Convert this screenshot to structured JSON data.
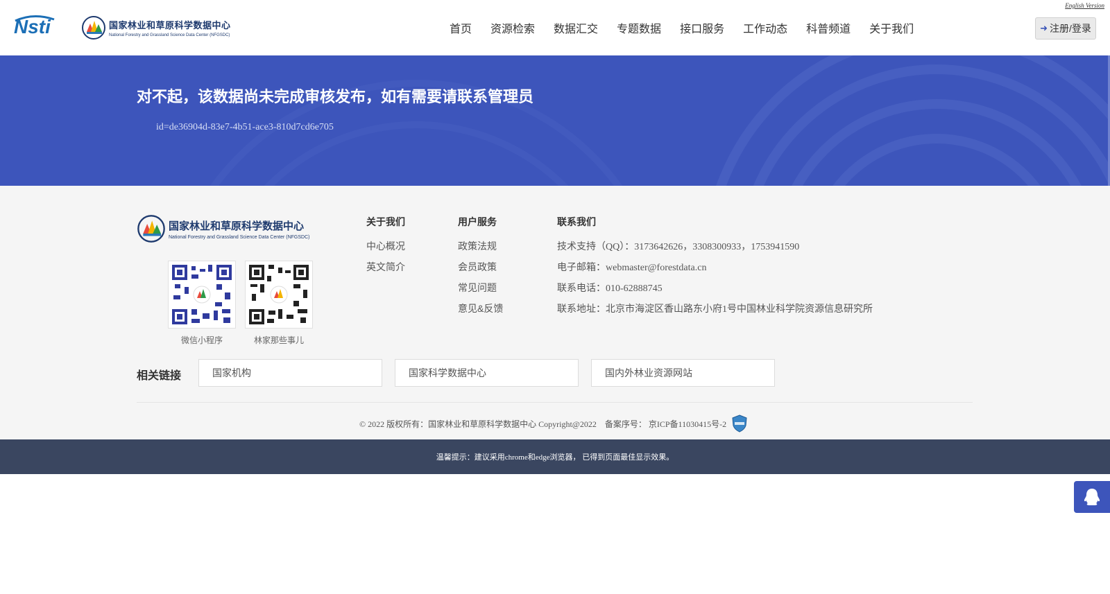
{
  "header": {
    "english_version": "English Version",
    "logo_nsti_text": "Nsti",
    "logo_center_cn": "国家林业和草原科学数据中心",
    "logo_center_en": "National Forestry and Grassland Science Data Center (NFGSDC)",
    "nav": [
      "首页",
      "资源检索",
      "数据汇交",
      "专题数据",
      "接口服务",
      "工作动态",
      "科普频道",
      "关于我们"
    ],
    "login_icon": "sign-in-icon",
    "login_label": "注册/登录"
  },
  "banner": {
    "title": "对不起，该数据尚未完成审核发布，如有需要请联系管理员",
    "id_text": "id=de36904d-83e7-4b51-ace3-810d7cd6e705",
    "bg_color": "#3d55bb"
  },
  "footer": {
    "logo_cn": "国家林业和草原科学数据中心",
    "logo_en": "National Forestry and Grassland Science Data Center (NFGSDC)",
    "qr_codes": [
      {
        "label": "微信小程序"
      },
      {
        "label": "林家那些事儿"
      }
    ],
    "about": {
      "title": "关于我们",
      "links": [
        "中心概况",
        "英文简介"
      ]
    },
    "service": {
      "title": "用户服务",
      "links": [
        "政策法规",
        "会员政策",
        "常见问题",
        "意见&反馈"
      ]
    },
    "contact": {
      "title": "联系我们",
      "lines": [
        "技术支持（QQ）：3173642626，3308300933，1753941590",
        "电子邮箱：webmaster@forestdata.cn",
        "联系电话：010-62888745",
        "联系地址：北京市海淀区香山路东小府1号中国林业科学院资源信息研究所"
      ]
    },
    "related": {
      "title": "相关链接",
      "links": [
        "国家机构",
        "国家科学数据中心",
        "国内外林业资源网站"
      ]
    },
    "copyright": "© 2022 版权所有：国家林业和草原科学数据中心 Copyright@2022",
    "icp": "备案序号： 京ICP备11030415号-2",
    "tip": "温馨提示：建议采用chrome和edge浏览器， 已得到页面最佳显示效果。"
  },
  "float": {
    "qq_icon": "qq-penguin-icon"
  }
}
